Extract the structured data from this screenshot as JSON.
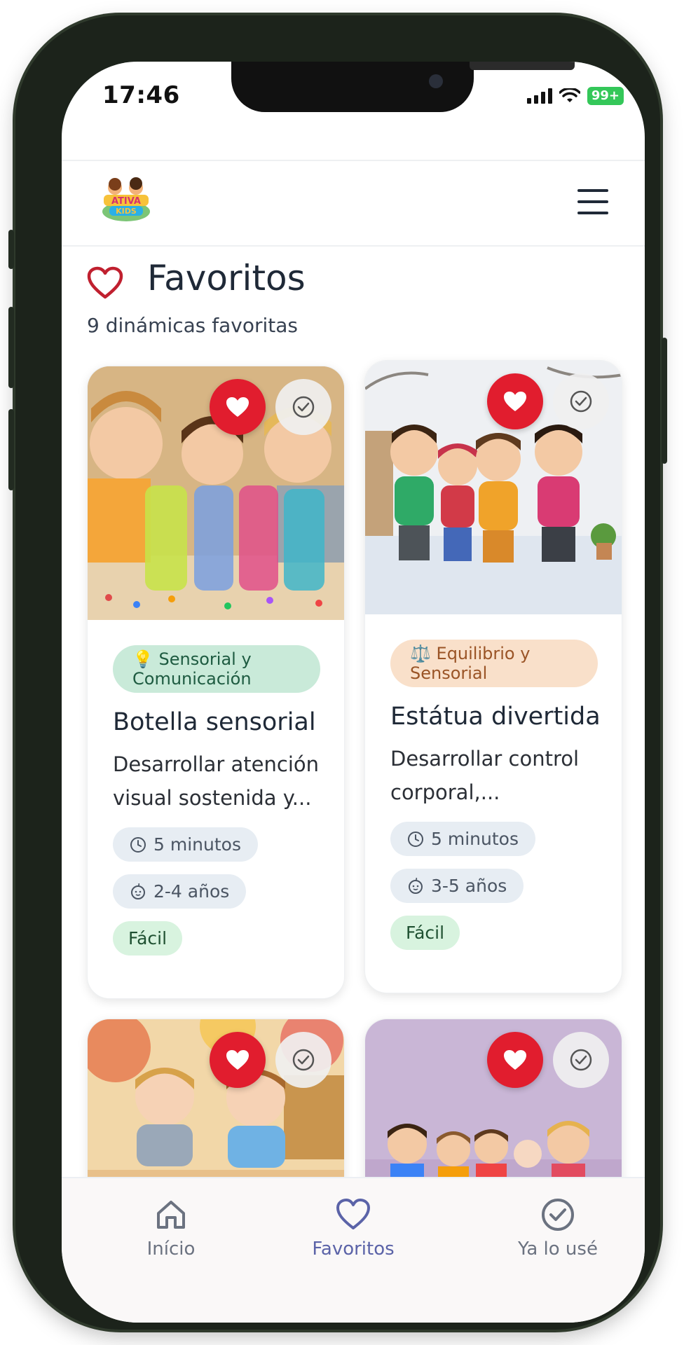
{
  "status_bar": {
    "time": "17:46",
    "battery": "99+"
  },
  "header": {
    "logo_alt": "Ativa Kids logo",
    "menu_icon": "hamburger-icon"
  },
  "page": {
    "title": "Favoritos",
    "subtitle": "9 dinámicas favoritas"
  },
  "cards": [
    {
      "category_icon": "💡",
      "category": "Sensorial y Comunicación",
      "title": "Botella sensorial",
      "description": "Desarrollar atención visual sostenida y...",
      "duration": "5 minutos",
      "age": "2-4 años",
      "difficulty": "Fácil"
    },
    {
      "category_icon": "⚖️",
      "category": "Equilibrio y Sensorial",
      "title": "Estátua divertida",
      "description": "Desarrollar control corporal,...",
      "duration": "5 minutos",
      "age": "3-5 años",
      "difficulty": "Fácil"
    }
  ],
  "bottom_nav": {
    "items": [
      {
        "label": "Início",
        "icon": "home-icon",
        "active": false
      },
      {
        "label": "Favoritos",
        "icon": "heart-icon",
        "active": true
      },
      {
        "label": "Ya lo usé",
        "icon": "check-circle-icon",
        "active": false
      }
    ],
    "active_color": "#5b63a8",
    "inactive_color": "#6b7280"
  },
  "colors": {
    "favorite_red": "#e11d2e",
    "title_heart": "#c0202f"
  }
}
